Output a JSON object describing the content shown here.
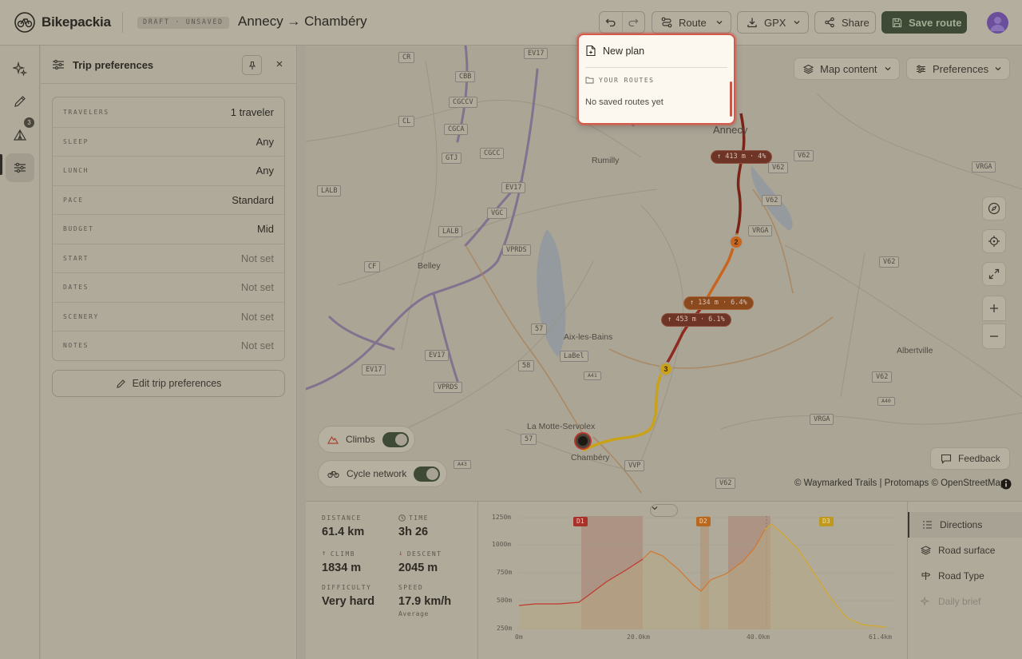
{
  "app": {
    "brand": "Bikepackia",
    "draft_label": "DRAFT · UNSAVED",
    "route_title": "Annecy → Chambéry"
  },
  "toolbar": {
    "undo_icon": "undo-icon",
    "redo_icon": "redo-icon",
    "route_label": "Route",
    "gpx_label": "GPX",
    "share_label": "Share",
    "save_label": "Save route"
  },
  "rail": {
    "badge": "3",
    "items": [
      "sparkle-icon",
      "pencil-icon",
      "tent-icon",
      "sliders-icon"
    ]
  },
  "preferences": {
    "title": "Trip preferences",
    "rows": [
      {
        "key": "TRAVELERS",
        "value": "1 traveler",
        "muted": false
      },
      {
        "key": "SLEEP",
        "value": "Any",
        "muted": false
      },
      {
        "key": "LUNCH",
        "value": "Any",
        "muted": false
      },
      {
        "key": "PACE",
        "value": "Standard",
        "muted": false
      },
      {
        "key": "BUDGET",
        "value": "Mid",
        "muted": false
      },
      {
        "key": "START",
        "value": "Not set",
        "muted": true
      },
      {
        "key": "DATES",
        "value": "Not set",
        "muted": true
      },
      {
        "key": "SCENERY",
        "value": "Not set",
        "muted": true
      },
      {
        "key": "NOTES",
        "value": "Not set",
        "muted": true
      }
    ],
    "edit_label": "Edit trip preferences"
  },
  "map": {
    "map_content_label": "Map content",
    "preferences_label": "Preferences",
    "places": [
      "Annecy",
      "Rumilly",
      "Belley",
      "Aix-les-Bains",
      "Albertville",
      "La Motte-Servolex",
      "Chambéry"
    ],
    "shields": [
      "CR",
      "EV17",
      "CBB",
      "CGCCV",
      "CL",
      "CGCA",
      "GTJ",
      "CGCC",
      "EV17",
      "LALB",
      "VGC",
      "LALB",
      "VPRDS",
      "CF",
      "V62",
      "V62",
      "VRGA",
      "V62",
      "VRGA",
      "V62",
      "57",
      "LaBel",
      "EV17",
      "EV17",
      "58",
      "VPRDS",
      "A41",
      "57",
      "VRGA",
      "V62",
      "VVP",
      "V62",
      "A40",
      "A43"
    ],
    "climbs": [
      {
        "label": "413 m · 4%"
      },
      {
        "label": "134 m · 6.4%"
      },
      {
        "label": "453 m · 6.1%"
      }
    ],
    "waypoints": [
      "2",
      "3"
    ],
    "toggles": {
      "climbs": "Climbs",
      "cycle_network": "Cycle network"
    },
    "feedback_label": "Feedback",
    "attribution": "© Waymarked Trails | Protomaps © OpenStreetMap",
    "controls": [
      "compass-icon",
      "locate-icon",
      "fullscreen-icon",
      "zoom-in-icon",
      "zoom-out-icon"
    ]
  },
  "stats": {
    "distance_label": "DISTANCE",
    "distance": "61.4 km",
    "time_label": "TIME",
    "time": "3h 26",
    "climb_label": "CLIMB",
    "climb": "1834 m",
    "descent_label": "DESCENT",
    "descent": "2045 m",
    "difficulty_label": "DIFFICULTY",
    "difficulty": "Very hard",
    "speed_label": "SPEED",
    "speed": "17.9 km/h",
    "speed_sub": "Average"
  },
  "elevation": {
    "y_ticks": [
      "1250m",
      "1000m",
      "750m",
      "500m",
      "250m"
    ],
    "x_ticks": [
      "0m",
      "20.0km",
      "40.0km",
      "61.4km"
    ],
    "day_labels": [
      "D1",
      "D2",
      "D3"
    ],
    "colors": {
      "d1": "#b03a2e",
      "d2": "#c87a1e",
      "d3": "#c9a21a",
      "line_red": "#c0392b",
      "line_orange": "#d4762a",
      "line_yellow": "#d4a72a"
    }
  },
  "tabs": {
    "items": [
      "Directions",
      "Road surface",
      "Road Type",
      "Daily brief"
    ]
  },
  "dropdown": {
    "new_plan": "New plan",
    "section": "YOUR ROUTES",
    "empty": "No saved routes yet"
  },
  "colors": {
    "accent": "#3e4a36",
    "highlight": "#d25b4c",
    "route_red": "#8e2a1e",
    "route_orange": "#c8651e",
    "route_yellow": "#c9a21a"
  }
}
